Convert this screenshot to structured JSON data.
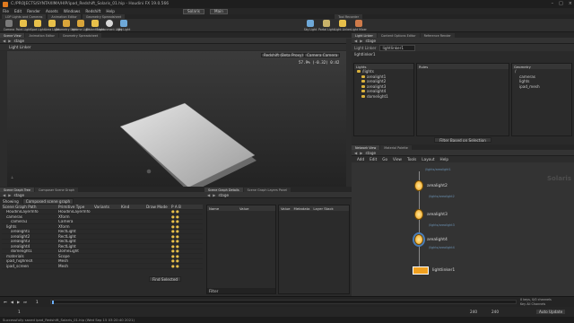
{
  "window": {
    "title": "C:/PROJECTS/SYNTAXIMA/HIP/ipad_Redshift_Solaris_01.hip - Houdini FX 19.0.566"
  },
  "menu": {
    "items": [
      "File",
      "Edit",
      "Render",
      "Assets",
      "Windows",
      "Redshift",
      "Help"
    ],
    "desktop": "Solaris",
    "main": "Main"
  },
  "shelf": {
    "tabs": [
      "LOP Lights and Cameras",
      "Animation Editor",
      "Geometry Spreadsheet"
    ],
    "right_tabs": [
      "Tool Recorder"
    ],
    "tools": [
      "Camera",
      "Point Light",
      "Spot Light",
      "Area Light",
      "Geometry Light",
      "Volume Light",
      "Distant Light",
      "Environment Light",
      "Sky Light",
      "Portal Light",
      "Light Linker"
    ],
    "right_tools": [
      "Sky Light",
      "Portal Light",
      "Light Linker",
      "Light Mixer"
    ]
  },
  "viewport": {
    "tabs": [
      "Scene View",
      "Animation Editor",
      "Geometry Spreadsheet"
    ],
    "path": "stage",
    "title": "Light Linker",
    "renderer": "Redshift (Beta Proxy)",
    "camera": "Camera Camera",
    "stats_fps": "57.9%",
    "stats_time": "(-0.32) 0:42"
  },
  "scene_graph": {
    "tabs": [
      "Scene Graph Tree",
      "Composer Scene Graph"
    ],
    "path": "stage",
    "showing": "Showing",
    "mode": "Composed scene graph",
    "columns": [
      "Scene Graph Path",
      "Primitive Type",
      "Variants",
      "Kind",
      "Draw Mode",
      "P A B"
    ],
    "rows": [
      {
        "path": "HoudiniLayerInfo",
        "type": "HoudiniLayerInfo"
      },
      {
        "path": "cameras",
        "type": "Xform"
      },
      {
        "path": "camera1",
        "type": "Camera"
      },
      {
        "path": "lights",
        "type": "Xform"
      },
      {
        "path": "arealight1",
        "type": "RectLight"
      },
      {
        "path": "arealight2",
        "type": "RectLight"
      },
      {
        "path": "arealight3",
        "type": "RectLight"
      },
      {
        "path": "arealight4",
        "type": "RectLight"
      },
      {
        "path": "domelight1",
        "type": "DomeLight"
      },
      {
        "path": "materials",
        "type": "Scope"
      },
      {
        "path": "ipad_highresX",
        "type": "Mesh"
      },
      {
        "path": "ipad_screen",
        "type": "Mesh"
      }
    ],
    "footer": "Find Selected"
  },
  "details": {
    "tabs": [
      "Scene Graph Details",
      "Scene Graph Layers Panel"
    ],
    "path": "stage",
    "name_col": "Name",
    "value_col": "Value",
    "filter": "Filter",
    "value_tabs": [
      "Value",
      "Metadata",
      "Layer Stack"
    ]
  },
  "light_linker": {
    "tabs": [
      "Light Linker",
      "Content Options Editor",
      "Reference Render"
    ],
    "path": "stage",
    "node": "lightlinker1",
    "lights_hdr": "Lights",
    "rules_hdr": "Rules",
    "geometry_hdr": "Geometry",
    "lights": [
      "/lights",
      "arealight1",
      "arealight2",
      "arealight3",
      "arealight4",
      "domelight1"
    ],
    "geometry": [
      "/",
      "cameras",
      "lights",
      "ipad_mesh"
    ],
    "filter_btn": "Filter Based on Selection"
  },
  "network": {
    "tabs": [
      "Network View",
      "Material Palette"
    ],
    "path": "stage",
    "menu": [
      "Add",
      "Edit",
      "Go",
      "View",
      "Tools",
      "Layout",
      "Help"
    ],
    "context": "Solaris",
    "nodes": [
      {
        "name": "arealight2",
        "sub": "/lights/arealight2"
      },
      {
        "name": "arealight3",
        "sub": "/lights/arealight3"
      },
      {
        "name": "arealight4",
        "sub": "/lights/arealight4"
      },
      {
        "name": "lightlinker1",
        "sub": ""
      }
    ],
    "top_sub": "/lights/arealight1"
  },
  "timeline": {
    "start": "1",
    "end": "240",
    "frame": "1",
    "right_a": "0 keys, 0/0 channels",
    "right_b": "Key All Channels",
    "auto": "Auto Update"
  },
  "status": {
    "text": "Successfully saved ipad_Redshift_Solaris_01.hip (Wed Sep 15 03:20:40 2021)"
  }
}
